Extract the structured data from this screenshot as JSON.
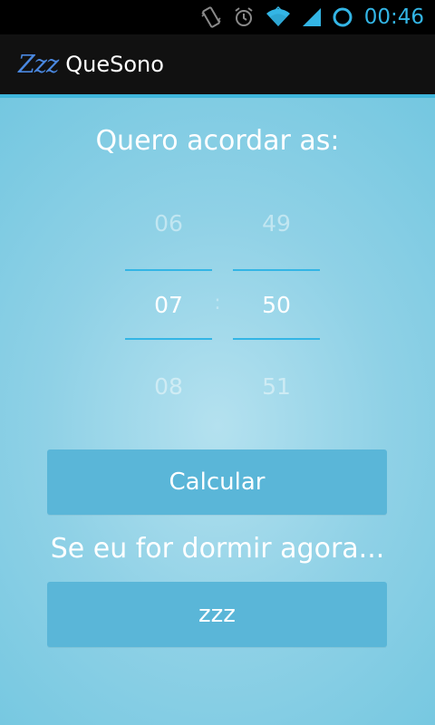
{
  "status_bar": {
    "time": "00:46",
    "icons": [
      "vibrate-icon",
      "alarm-icon",
      "wifi-icon",
      "signal-icon",
      "sync-icon"
    ]
  },
  "action_bar": {
    "icon_text": "Zzz",
    "title": "QueSono"
  },
  "main": {
    "heading": "Quero acordar as:",
    "hour_picker": {
      "prev": "06",
      "current": "07",
      "next": "08"
    },
    "minute_picker": {
      "prev": "49",
      "current": "50",
      "next": "51"
    },
    "separator": ":",
    "calculate_label": "Calcular",
    "sleep_now_text": "Se eu for dormir agora...",
    "sleep_button_label": "zzz"
  },
  "colors": {
    "accent": "#33b5e5",
    "background": "#8fd1e6",
    "button": "#5ab6d8"
  }
}
